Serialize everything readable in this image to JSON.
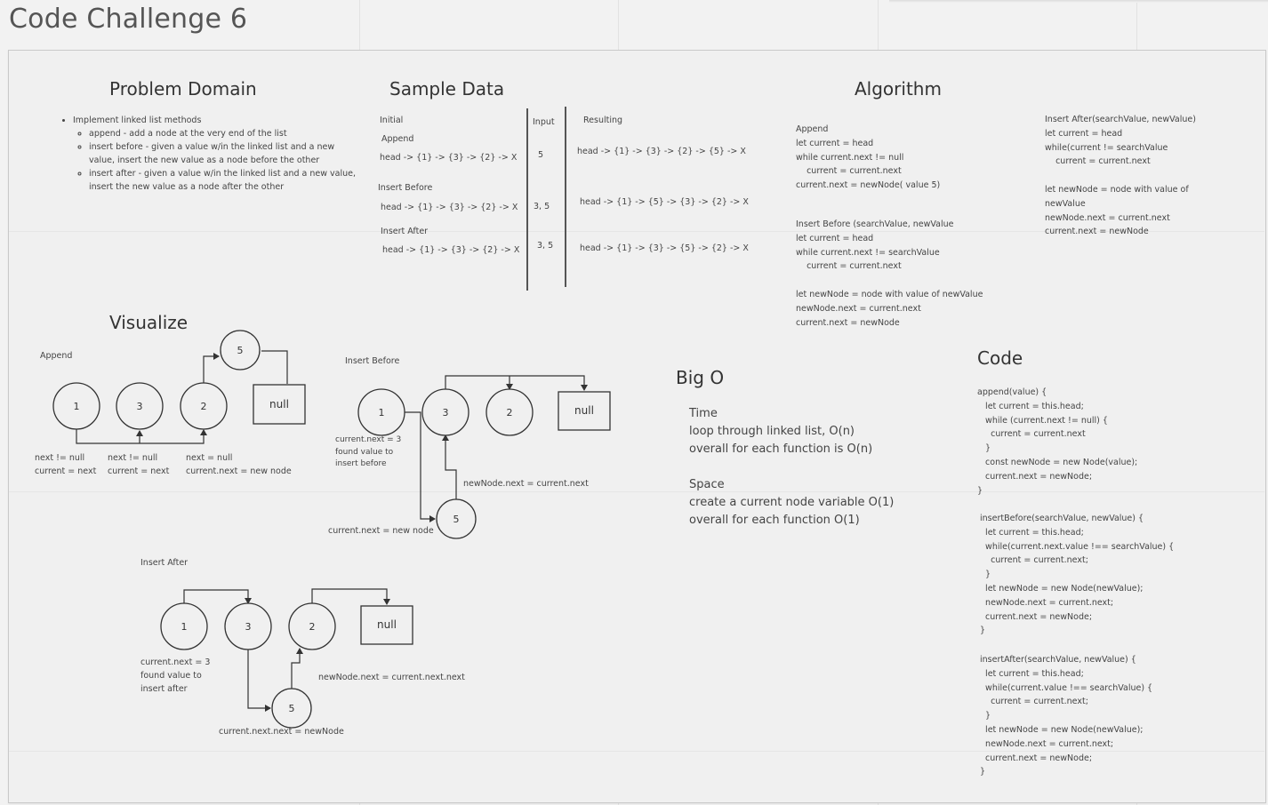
{
  "board": {
    "title": "Code Challenge 6"
  },
  "problem_domain": {
    "heading": "Problem Domain",
    "bullet": "Implement linked list methods",
    "sub_bullets": [
      "append - add a node at the very end of the list",
      "insert before - given a value w/in the linked list  and a new value, insert the new value as a node before the other",
      "insert after - given a value w/in the linked list and a new value, insert the new value as a node after the other"
    ]
  },
  "sample_data": {
    "heading": "Sample Data",
    "col_initial": "Initial",
    "col_input": "Input",
    "col_resulting": "Resulting",
    "rows": [
      {
        "label": "Append",
        "initial": "head -> {1} -> {3} -> {2} -> X",
        "input": "5",
        "result": "head -> {1} -> {3} -> {2} -> {5} -> X"
      },
      {
        "label": "Insert Before",
        "initial": "head -> {1} -> {3} -> {2} -> X",
        "input": "3, 5",
        "result": "head -> {1} -> {5} -> {3} -> {2} -> X"
      },
      {
        "label": "Insert After",
        "initial": "head -> {1} -> {3} -> {2} -> X",
        "input": "3, 5",
        "result": "head -> {1} -> {3} -> {5} -> {2} -> X"
      }
    ]
  },
  "algorithm": {
    "heading": "Algorithm",
    "append": "Append\nlet current = head\nwhile current.next != null\n    current = current.next\ncurrent.next = newNode( value 5)",
    "insert_before": "Insert Before (searchValue, newValue\nlet current = head\nwhile current.next != searchValue\n    current = current.next\n\nlet newNode = node with value of newValue\nnewNode.next = current.next\ncurrent.next = newNode",
    "insert_after": "Insert After(searchValue, newValue)\nlet current = head\nwhile(current != searchValue\n    current = current.next\n\nlet newNode = node with value of\nnewValue\nnewNode.next = current.next\ncurrent.next = newNode"
  },
  "visualize": {
    "heading": "Visualize",
    "append": {
      "label": "Append",
      "nodes": [
        "1",
        "3",
        "2",
        "5",
        "null"
      ],
      "notes": [
        "next != null\ncurrent = next",
        "next != null\ncurrent = next",
        "next = null\ncurrent.next = new node"
      ]
    },
    "insert_before": {
      "label": "Insert Before",
      "nodes": [
        "1",
        "3",
        "2",
        "null",
        "5"
      ],
      "note_found": "current.next = 3\nfound value to\ninsert before",
      "note_new": "newNode.next = current.next",
      "note_current": "current.next = new node"
    },
    "insert_after": {
      "label": "Insert After",
      "nodes": [
        "1",
        "3",
        "2",
        "null",
        "5"
      ],
      "note_found": "current.next = 3\nfound value to\ninsert after",
      "note_new": "newNode.next = current.next.next",
      "note_current": "current.next.next = newNode"
    }
  },
  "big_o": {
    "heading": "Big O",
    "time": "Time\nloop through linked list, O(n)\noverall for each function is O(n)",
    "space": "Space\ncreate a current node variable O(1)\noverall for each function O(1)"
  },
  "code": {
    "heading": "Code",
    "append": "append(value) {\n   let current = this.head;\n   while (current.next != null) {\n     current = current.next\n   }\n   const newNode = new Node(value);\n   current.next = newNode;\n}",
    "insert_before": " insertBefore(searchValue, newValue) {\n   let current = this.head;\n   while(current.next.value !== searchValue) {\n     current = current.next;\n   }\n   let newNode = new Node(newValue);\n   newNode.next = current.next;\n   current.next = newNode;\n }",
    "insert_after": " insertAfter(searchValue, newValue) {\n   let current = this.head;\n   while(current.value !== searchValue) {\n     current = current.next;\n   }\n   let newNode = new Node(newValue);\n   newNode.next = current.next;\n   current.next = newNode;\n }"
  }
}
